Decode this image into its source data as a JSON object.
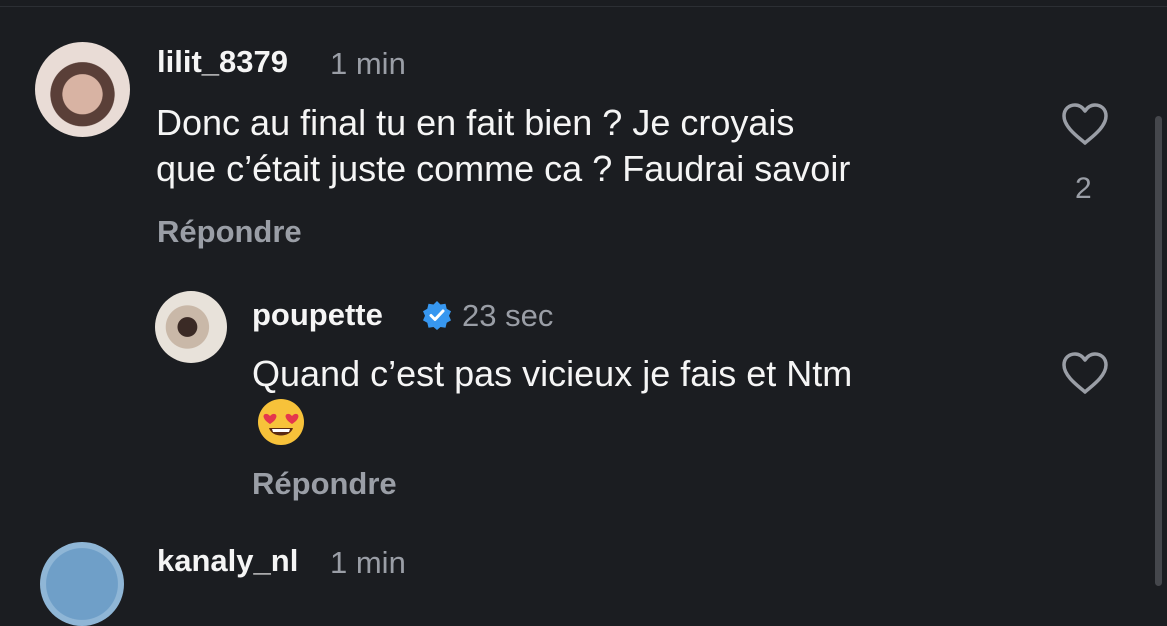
{
  "comments": [
    {
      "username": "lilit_8379",
      "time": "1 min",
      "text_line1": "Donc au final tu en fait bien ? Je croyais",
      "text_line2": "que c’était juste comme ca ? Faudrai savoir",
      "reply_label": "Répondre",
      "like_count": "2"
    },
    {
      "username": "poupette",
      "verified": true,
      "time": "23 sec",
      "text_line1": "Quand c’est pas vicieux je fais et Ntm",
      "emoji": "heart-eyes-emoji",
      "reply_label": "Répondre"
    },
    {
      "username": "kanaly_nl",
      "time": "1 min"
    }
  ],
  "colors": {
    "background": "#1b1d21",
    "primary_text": "#f5f5f5",
    "secondary_text": "#9a9ea6",
    "verified_blue": "#3797f0"
  }
}
